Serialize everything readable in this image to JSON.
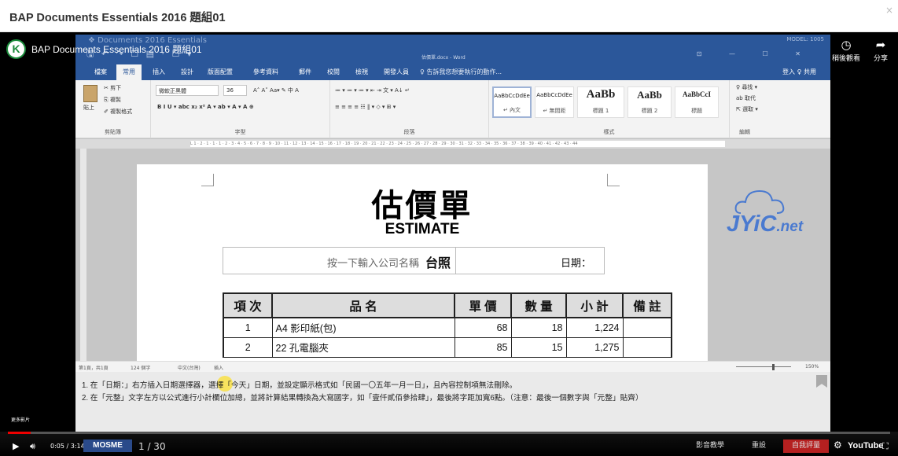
{
  "modal": {
    "title": "BAP Documents Essentials 2016 題組01",
    "close": "×"
  },
  "youtube": {
    "channel_logo": "K",
    "video_title": "BAP Documents Essentials 2016 題組01",
    "watch_later": "稍後觀看",
    "share": "分享",
    "more_videos": "更多影片",
    "time": "0:05 / 3:14",
    "progress_fraction": 0.026,
    "youtube_label": "YouTube"
  },
  "word": {
    "doc_label": "❖ Documents 2016 Essentials",
    "quick_access": "🖫 ↶ ↷ ☐ ▤ · ☐ ▾",
    "file_name": "估價單.docx - Word",
    "model": "MODEL: 1005",
    "window_controls": "⊡ — ☐ ✕",
    "tabs": [
      "檔案",
      "常用",
      "插入",
      "設計",
      "版面配置",
      "參考資料",
      "郵件",
      "校閱",
      "檢視",
      "開發人員"
    ],
    "tell_me": "♀ 告訴我您想要執行的動作...",
    "sign_in": "登入",
    "share": "♀ 共用",
    "clipboard": {
      "cut": "✂ 剪下",
      "copy": "⎘ 複製",
      "paste": "貼上",
      "format_painter": "✐ 複製格式",
      "label": "剪貼簿"
    },
    "font": {
      "name": "微軟正黑體",
      "size": "36",
      "grow_shrink": "A˄ A˅  Aa▾  ✎ 中 A",
      "format": "B  I  U ▾ abc x₂ x²  A ▾ ab ▾ A ▾ A ⊕",
      "label": "字型"
    },
    "paragraph": {
      "row1": "≔ ▾ ≔ ▾ ≔ ▾  ⇤ ⇥  文 ▾  A↓  ↵",
      "row2": "≡  ≡  ≡  ≡  ☷  ‖ ▾  ◇ ▾  ⊞ ▾",
      "label": "段落"
    },
    "styles": [
      {
        "sample": "AaBbCcDdEe",
        "name": "↵ 內文"
      },
      {
        "sample": "AaBbCcDdEe",
        "name": "↵ 無間距"
      },
      {
        "sample": "AaBb",
        "name": "標題 1"
      },
      {
        "sample": "AaBb",
        "name": "標題 2"
      },
      {
        "sample": "AaBbCcI",
        "name": "標題"
      }
    ],
    "styles_label": "樣式",
    "editing": {
      "find": "♀ 尋找 ▾",
      "replace": "ab 取代",
      "select": "⇱ 選取 ▾",
      "label": "編輯"
    },
    "ruler": "L  1 · 2 · 1 · 1 · 1 · 2 · 3 · 4 · 5 · 6 · 7 · 8 · 9 · 10 · 11 · 12 · 13 · 14 · 15 · 16 · 17 · 18 · 19 · 20 · 21 · 22 · 23 · 24 · 25 · 26 · 27 · 28 · 29 · 30 · 31 · 32 · 33 · 34 · 35 · 36 · 37 · 38 · 39 · 40 · 41 · 42 · 43 · 44",
    "status": {
      "page": "第1頁，共1頁",
      "words": "124 個字",
      "lang": "中文(台灣)",
      "insert": "插入",
      "zoom": "150%"
    }
  },
  "document": {
    "title": "估價單",
    "subtitle": "ESTIMATE",
    "company_placeholder": "按一下輸入公司名稱",
    "company_suffix": "台照",
    "date_label": "日期：",
    "table": {
      "headers": [
        "項 次",
        "品 名",
        "單 價",
        "數 量",
        "小 計",
        "備 註"
      ],
      "rows": [
        {
          "no": "1",
          "name": "A4 影印紙(包)",
          "price": "68",
          "qty": "18",
          "subtotal": "1,224",
          "note": ""
        },
        {
          "no": "2",
          "name": "22 孔電腦夾",
          "price": "85",
          "qty": "15",
          "subtotal": "1,275",
          "note": ""
        }
      ]
    }
  },
  "watermark": {
    "logo": "JYiC",
    "suffix": ".net"
  },
  "instructions": {
    "line1": "1. 在「日期：」右方插入日期選擇器，選擇「今天」日期，並設定顯示格式如「民國一〇五年一月一日」，且內容控制項無法刪除。",
    "line2": "2. 在「元整」文字左方以公式進行小計欄位加總，並將計算結果轉換為大寫國字，如「壹仟貳佰參拾肆」，最後將字距加寬6點。（注意：最後一個數字與「元整」貼齊）"
  },
  "bottom": {
    "logo": "MOSME",
    "page": "1 / 30",
    "audio_lesson": "影音教學",
    "redo": "重設",
    "self_test": "自我評量"
  }
}
